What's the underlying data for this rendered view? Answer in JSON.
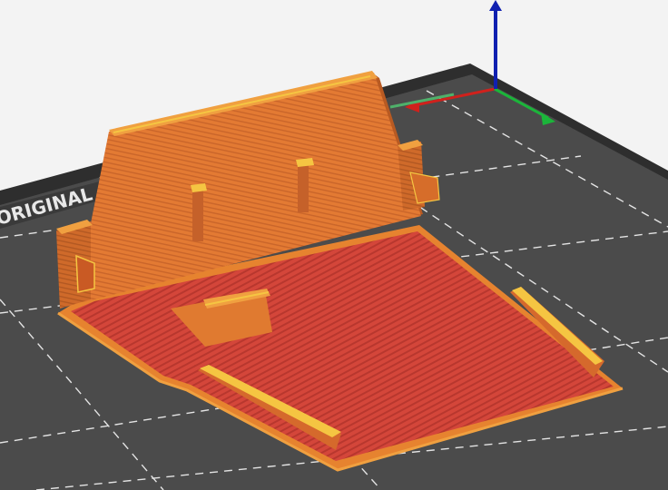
{
  "viewport": {
    "bed_logo_text": "ORIGINAL",
    "axes": [
      "x-axis",
      "y-axis",
      "z-axis"
    ],
    "colors": {
      "background": "#f3f3f3",
      "bed": "#4a4a4a",
      "bed_edge": "#383838",
      "grid_line": "#e6e6e6",
      "perimeter": "#e67a2e",
      "infill": "#d9443a",
      "top_highlight": "#f5c542",
      "axis_x": "#d0211c",
      "axis_y": "#1bb53a",
      "axis_z": "#1020b0"
    }
  }
}
